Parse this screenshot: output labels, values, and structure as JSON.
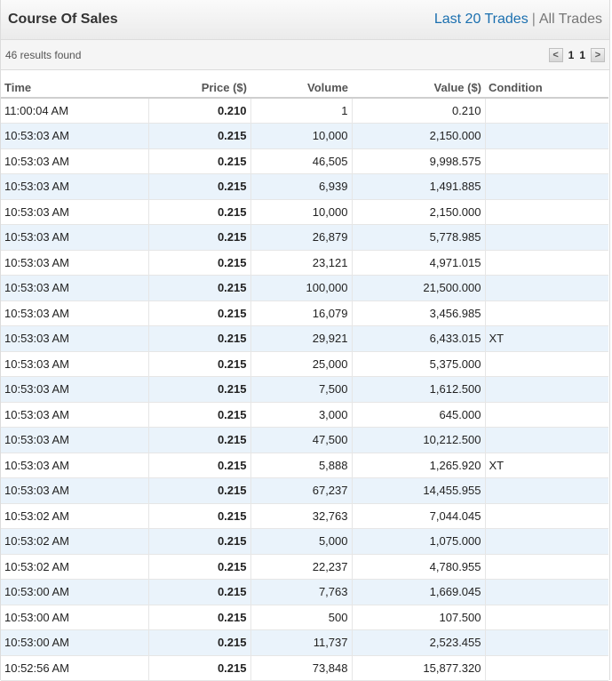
{
  "header": {
    "title": "Course Of Sales",
    "last_trades_link": "Last 20 Trades",
    "separator": "|",
    "all_trades_link": "All Trades"
  },
  "subbar": {
    "results_text": "46 results found",
    "prev": "<",
    "page_current": "1",
    "page_total": "1",
    "next": ">"
  },
  "columns": [
    "Time",
    "Price ($)",
    "Volume",
    "Value ($)",
    "Condition"
  ],
  "rows": [
    {
      "time": "11:00:04 AM",
      "price": "0.210",
      "volume": "1",
      "value": "0.210",
      "condition": ""
    },
    {
      "time": "10:53:03 AM",
      "price": "0.215",
      "volume": "10,000",
      "value": "2,150.000",
      "condition": ""
    },
    {
      "time": "10:53:03 AM",
      "price": "0.215",
      "volume": "46,505",
      "value": "9,998.575",
      "condition": ""
    },
    {
      "time": "10:53:03 AM",
      "price": "0.215",
      "volume": "6,939",
      "value": "1,491.885",
      "condition": ""
    },
    {
      "time": "10:53:03 AM",
      "price": "0.215",
      "volume": "10,000",
      "value": "2,150.000",
      "condition": ""
    },
    {
      "time": "10:53:03 AM",
      "price": "0.215",
      "volume": "26,879",
      "value": "5,778.985",
      "condition": ""
    },
    {
      "time": "10:53:03 AM",
      "price": "0.215",
      "volume": "23,121",
      "value": "4,971.015",
      "condition": ""
    },
    {
      "time": "10:53:03 AM",
      "price": "0.215",
      "volume": "100,000",
      "value": "21,500.000",
      "condition": ""
    },
    {
      "time": "10:53:03 AM",
      "price": "0.215",
      "volume": "16,079",
      "value": "3,456.985",
      "condition": ""
    },
    {
      "time": "10:53:03 AM",
      "price": "0.215",
      "volume": "29,921",
      "value": "6,433.015",
      "condition": "XT"
    },
    {
      "time": "10:53:03 AM",
      "price": "0.215",
      "volume": "25,000",
      "value": "5,375.000",
      "condition": ""
    },
    {
      "time": "10:53:03 AM",
      "price": "0.215",
      "volume": "7,500",
      "value": "1,612.500",
      "condition": ""
    },
    {
      "time": "10:53:03 AM",
      "price": "0.215",
      "volume": "3,000",
      "value": "645.000",
      "condition": ""
    },
    {
      "time": "10:53:03 AM",
      "price": "0.215",
      "volume": "47,500",
      "value": "10,212.500",
      "condition": ""
    },
    {
      "time": "10:53:03 AM",
      "price": "0.215",
      "volume": "5,888",
      "value": "1,265.920",
      "condition": "XT"
    },
    {
      "time": "10:53:03 AM",
      "price": "0.215",
      "volume": "67,237",
      "value": "14,455.955",
      "condition": ""
    },
    {
      "time": "10:53:02 AM",
      "price": "0.215",
      "volume": "32,763",
      "value": "7,044.045",
      "condition": ""
    },
    {
      "time": "10:53:02 AM",
      "price": "0.215",
      "volume": "5,000",
      "value": "1,075.000",
      "condition": ""
    },
    {
      "time": "10:53:02 AM",
      "price": "0.215",
      "volume": "22,237",
      "value": "4,780.955",
      "condition": ""
    },
    {
      "time": "10:53:00 AM",
      "price": "0.215",
      "volume": "7,763",
      "value": "1,669.045",
      "condition": ""
    },
    {
      "time": "10:53:00 AM",
      "price": "0.215",
      "volume": "500",
      "value": "107.500",
      "condition": ""
    },
    {
      "time": "10:53:00 AM",
      "price": "0.215",
      "volume": "11,737",
      "value": "2,523.455",
      "condition": ""
    },
    {
      "time": "10:52:56 AM",
      "price": "0.215",
      "volume": "73,848",
      "value": "15,877.320",
      "condition": ""
    }
  ]
}
